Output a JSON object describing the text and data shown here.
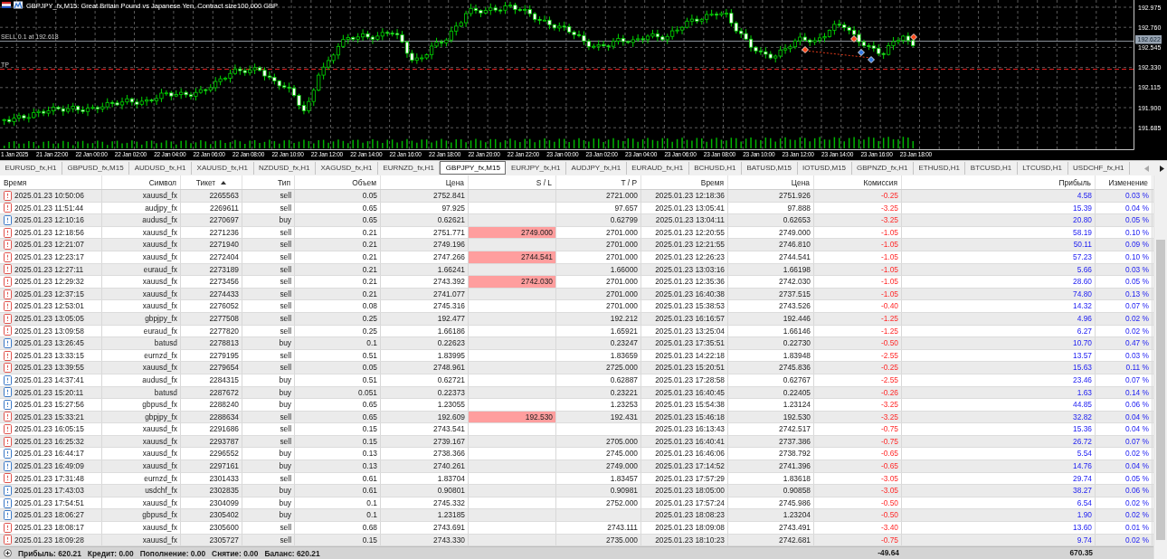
{
  "chart": {
    "title": "GBPJPY_fx,M15: Great Britain Pound vs Japanese Yen, Contract size100,000 GBP",
    "order_label": "SELL 0.1 at 192.618",
    "tp_label": "TP",
    "current_price": "192.622",
    "price_labels": [
      "192.975",
      "192.760",
      "192.545",
      "192.330",
      "192.115",
      "191.900",
      "191.685"
    ],
    "time_labels": [
      "1 Jan 2025",
      "21 Jan 22:00",
      "22 Jan 00:00",
      "22 Jan 02:00",
      "22 Jan 04:00",
      "22 Jan 06:00",
      "22 Jan 08:00",
      "22 Jan 10:00",
      "22 Jan 12:00",
      "22 Jan 14:00",
      "22 Jan 16:00",
      "22 Jan 18:00",
      "22 Jan 20:00",
      "22 Jan 22:00",
      "23 Jan 00:00",
      "23 Jan 02:00",
      "23 Jan 04:00",
      "23 Jan 06:00",
      "23 Jan 08:00",
      "23 Jan 10:00",
      "23 Jan 12:00",
      "23 Jan 14:00",
      "23 Jan 16:00",
      "23 Jan 18:00"
    ]
  },
  "tabs": [
    {
      "label": "EURUSD_fx,H1",
      "selected": false
    },
    {
      "label": "GBPUSD_fx,M15",
      "selected": false
    },
    {
      "label": "AUDUSD_fx,H1",
      "selected": false
    },
    {
      "label": "XAUUSD_fx,H1",
      "selected": false
    },
    {
      "label": "NZDUSD_fx,H1",
      "selected": false
    },
    {
      "label": "XAGUSD_fx,H1",
      "selected": false
    },
    {
      "label": "EURNZD_fx,H1",
      "selected": false
    },
    {
      "label": "GBPJPY_fx,M15",
      "selected": true
    },
    {
      "label": "EURJPY_fx,H1",
      "selected": false
    },
    {
      "label": "AUDJPY_fx,H1",
      "selected": false
    },
    {
      "label": "EURAUD_fx,H1",
      "selected": false
    },
    {
      "label": "BCHUSD,H1",
      "selected": false
    },
    {
      "label": "BATUSD,M15",
      "selected": false
    },
    {
      "label": "IOTUSD,M15",
      "selected": false
    },
    {
      "label": "GBPNZD_fx,H1",
      "selected": false
    },
    {
      "label": "ETHUSD,H1",
      "selected": false
    },
    {
      "label": "BTCUSD,H1",
      "selected": false
    },
    {
      "label": "LTCUSD,H1",
      "selected": false
    },
    {
      "label": "USDCHF_fx,H1",
      "selected": false
    }
  ],
  "tab_scroll": {
    "back_disabled": true,
    "forward_disabled": false
  },
  "table": {
    "columns": [
      {
        "label": "Время",
        "sorted": false
      },
      {
        "label": "Символ",
        "sorted": false
      },
      {
        "label": "Тикет",
        "sorted": true
      },
      {
        "label": "Тип",
        "sorted": false
      },
      {
        "label": "Объем",
        "sorted": false
      },
      {
        "label": "Цена",
        "sorted": false
      },
      {
        "label": "S / L",
        "sorted": false
      },
      {
        "label": "T / P",
        "sorted": false
      },
      {
        "label": "Время",
        "sorted": false
      },
      {
        "label": "Цена",
        "sorted": false
      },
      {
        "label": "Комиссия",
        "sorted": false
      },
      {
        "label": "Прибыль",
        "sorted": false
      },
      {
        "label": "Изменение",
        "sorted": false
      }
    ],
    "rows": [
      {
        "time": "2025.01.23 10:50:06",
        "symbol": "xauusd_fx",
        "ticket": "2265563",
        "type": "sell",
        "volume": "0.05",
        "price": "2752.841",
        "tp": "2721.000",
        "close_time": "2025.01.23 12:18:36",
        "close_price": "2751.926",
        "commission": "-0.25",
        "profit": "4.58",
        "change": "0.03 %",
        "kind": "sell",
        "sl_highlighted": false
      },
      {
        "time": "2025.01.23 11:51:44",
        "symbol": "audjpy_fx",
        "ticket": "2269611",
        "type": "sell",
        "volume": "0.65",
        "price": "97.925",
        "tp": "97.657",
        "close_time": "2025.01.23 13:05:41",
        "close_price": "97.888",
        "commission": "-3.25",
        "profit": "15.39",
        "change": "0.04 %",
        "kind": "sell",
        "sl_highlighted": false
      },
      {
        "time": "2025.01.23 12:10:16",
        "symbol": "audusd_fx",
        "ticket": "2270697",
        "type": "buy",
        "volume": "0.65",
        "price": "0.62621",
        "tp": "0.62799",
        "close_time": "2025.01.23 13:04:11",
        "close_price": "0.62653",
        "commission": "-3.25",
        "profit": "20.80",
        "change": "0.05 %",
        "kind": "buy",
        "sl_highlighted": false
      },
      {
        "time": "2025.01.23 12:18:56",
        "symbol": "xauusd_fx",
        "ticket": "2271236",
        "type": "sell",
        "volume": "0.21",
        "price": "2751.771",
        "sl": "2749.000",
        "tp": "2701.000",
        "close_time": "2025.01.23 12:20:55",
        "close_price": "2749.000",
        "commission": "-1.05",
        "profit": "58.19",
        "change": "0.10 %",
        "kind": "sell",
        "sl_highlighted": true
      },
      {
        "time": "2025.01.23 12:21:07",
        "symbol": "xauusd_fx",
        "ticket": "2271940",
        "type": "sell",
        "volume": "0.21",
        "price": "2749.196",
        "tp": "2701.000",
        "close_time": "2025.01.23 12:21:55",
        "close_price": "2746.810",
        "commission": "-1.05",
        "profit": "50.11",
        "change": "0.09 %",
        "kind": "sell",
        "sl_highlighted": false
      },
      {
        "time": "2025.01.23 12:23:17",
        "symbol": "xauusd_fx",
        "ticket": "2272404",
        "type": "sell",
        "volume": "0.21",
        "price": "2747.266",
        "sl": "2744.541",
        "tp": "2701.000",
        "close_time": "2025.01.23 12:26:23",
        "close_price": "2744.541",
        "commission": "-1.05",
        "profit": "57.23",
        "change": "0.10 %",
        "kind": "sell",
        "sl_highlighted": true
      },
      {
        "time": "2025.01.23 12:27:11",
        "symbol": "euraud_fx",
        "ticket": "2273189",
        "type": "sell",
        "volume": "0.21",
        "price": "1.66241",
        "tp": "1.66000",
        "close_time": "2025.01.23 13:03:16",
        "close_price": "1.66198",
        "commission": "-1.05",
        "profit": "5.66",
        "change": "0.03 %",
        "kind": "sell",
        "sl_highlighted": false
      },
      {
        "time": "2025.01.23 12:29:32",
        "symbol": "xauusd_fx",
        "ticket": "2273456",
        "type": "sell",
        "volume": "0.21",
        "price": "2743.392",
        "sl": "2742.030",
        "tp": "2701.000",
        "close_time": "2025.01.23 12:35:36",
        "close_price": "2742.030",
        "commission": "-1.05",
        "profit": "28.60",
        "change": "0.05 %",
        "kind": "sell",
        "sl_highlighted": true
      },
      {
        "time": "2025.01.23 12:37:15",
        "symbol": "xauusd_fx",
        "ticket": "2274433",
        "type": "sell",
        "volume": "0.21",
        "price": "2741.077",
        "tp": "2701.000",
        "close_time": "2025.01.23 16:40:38",
        "close_price": "2737.515",
        "commission": "-1.05",
        "profit": "74.80",
        "change": "0.13 %",
        "kind": "sell",
        "sl_highlighted": false
      },
      {
        "time": "2025.01.23 12:53:01",
        "symbol": "xauusd_fx",
        "ticket": "2276052",
        "type": "sell",
        "volume": "0.08",
        "price": "2745.316",
        "tp": "2701.000",
        "close_time": "2025.01.23 15:38:53",
        "close_price": "2743.526",
        "commission": "-0.40",
        "profit": "14.32",
        "change": "0.07 %",
        "kind": "sell",
        "sl_highlighted": false
      },
      {
        "time": "2025.01.23 13:05:05",
        "symbol": "gbpjpy_fx",
        "ticket": "2277508",
        "type": "sell",
        "volume": "0.25",
        "price": "192.477",
        "tp": "192.212",
        "close_time": "2025.01.23 16:16:57",
        "close_price": "192.446",
        "commission": "-1.25",
        "profit": "4.96",
        "change": "0.02 %",
        "kind": "sell",
        "sl_highlighted": false
      },
      {
        "time": "2025.01.23 13:09:58",
        "symbol": "euraud_fx",
        "ticket": "2277820",
        "type": "sell",
        "volume": "0.25",
        "price": "1.66186",
        "tp": "1.65921",
        "close_time": "2025.01.23 13:25:04",
        "close_price": "1.66146",
        "commission": "-1.25",
        "profit": "6.27",
        "change": "0.02 %",
        "kind": "sell",
        "sl_highlighted": false
      },
      {
        "time": "2025.01.23 13:26:45",
        "symbol": "batusd",
        "ticket": "2278813",
        "type": "buy",
        "volume": "0.1",
        "price": "0.22623",
        "tp": "0.23247",
        "close_time": "2025.01.23 17:35:51",
        "close_price": "0.22730",
        "commission": "-0.50",
        "profit": "10.70",
        "change": "0.47 %",
        "kind": "buy",
        "sl_highlighted": false
      },
      {
        "time": "2025.01.23 13:33:15",
        "symbol": "eurnzd_fx",
        "ticket": "2279195",
        "type": "sell",
        "volume": "0.51",
        "price": "1.83995",
        "tp": "1.83659",
        "close_time": "2025.01.23 14:22:18",
        "close_price": "1.83948",
        "commission": "-2.55",
        "profit": "13.57",
        "change": "0.03 %",
        "kind": "sell",
        "sl_highlighted": false
      },
      {
        "time": "2025.01.23 13:39:55",
        "symbol": "xauusd_fx",
        "ticket": "2279654",
        "type": "sell",
        "volume": "0.05",
        "price": "2748.961",
        "tp": "2725.000",
        "close_time": "2025.01.23 15:20:51",
        "close_price": "2745.836",
        "commission": "-0.25",
        "profit": "15.63",
        "change": "0.11 %",
        "kind": "sell",
        "sl_highlighted": false
      },
      {
        "time": "2025.01.23 14:37:41",
        "symbol": "audusd_fx",
        "ticket": "2284315",
        "type": "buy",
        "volume": "0.51",
        "price": "0.62721",
        "tp": "0.62887",
        "close_time": "2025.01.23 17:28:58",
        "close_price": "0.62767",
        "commission": "-2.55",
        "profit": "23.46",
        "change": "0.07 %",
        "kind": "buy",
        "sl_highlighted": false
      },
      {
        "time": "2025.01.23 15:20:11",
        "symbol": "batusd",
        "ticket": "2287672",
        "type": "buy",
        "volume": "0.051",
        "price": "0.22373",
        "tp": "0.23221",
        "close_time": "2025.01.23 16:40:45",
        "close_price": "0.22405",
        "commission": "-0.26",
        "profit": "1.63",
        "change": "0.14 %",
        "kind": "buy",
        "sl_highlighted": false
      },
      {
        "time": "2025.01.23 15:27:56",
        "symbol": "gbpusd_fx",
        "ticket": "2288240",
        "type": "buy",
        "volume": "0.65",
        "price": "1.23055",
        "tp": "1.23253",
        "close_time": "2025.01.23 15:54:38",
        "close_price": "1.23124",
        "commission": "-3.25",
        "profit": "44.85",
        "change": "0.06 %",
        "kind": "buy",
        "sl_highlighted": false
      },
      {
        "time": "2025.01.23 15:33:21",
        "symbol": "gbpjpy_fx",
        "ticket": "2288634",
        "type": "sell",
        "volume": "0.65",
        "price": "192.609",
        "sl": "192.530",
        "tp": "192.431",
        "close_time": "2025.01.23 15:46:18",
        "close_price": "192.530",
        "commission": "-3.25",
        "profit": "32.82",
        "change": "0.04 %",
        "kind": "sell",
        "sl_highlighted": true
      },
      {
        "time": "2025.01.23 16:05:15",
        "symbol": "xauusd_fx",
        "ticket": "2291686",
        "type": "sell",
        "volume": "0.15",
        "price": "2743.541",
        "close_time": "2025.01.23 16:13:43",
        "close_price": "2742.517",
        "commission": "-0.75",
        "profit": "15.36",
        "change": "0.04 %",
        "kind": "sell",
        "sl_highlighted": false
      },
      {
        "time": "2025.01.23 16:25:32",
        "symbol": "xauusd_fx",
        "ticket": "2293787",
        "type": "sell",
        "volume": "0.15",
        "price": "2739.167",
        "tp": "2705.000",
        "close_time": "2025.01.23 16:40:41",
        "close_price": "2737.386",
        "commission": "-0.75",
        "profit": "26.72",
        "change": "0.07 %",
        "kind": "sell",
        "sl_highlighted": false
      },
      {
        "time": "2025.01.23 16:44:17",
        "symbol": "xauusd_fx",
        "ticket": "2296552",
        "type": "buy",
        "volume": "0.13",
        "price": "2738.366",
        "tp": "2745.000",
        "close_time": "2025.01.23 16:46:06",
        "close_price": "2738.792",
        "commission": "-0.65",
        "profit": "5.54",
        "change": "0.02 %",
        "kind": "buy",
        "sl_highlighted": false
      },
      {
        "time": "2025.01.23 16:49:09",
        "symbol": "xauusd_fx",
        "ticket": "2297161",
        "type": "buy",
        "volume": "0.13",
        "price": "2740.261",
        "tp": "2749.000",
        "close_time": "2025.01.23 17:14:52",
        "close_price": "2741.396",
        "commission": "-0.65",
        "profit": "14.76",
        "change": "0.04 %",
        "kind": "buy",
        "sl_highlighted": false
      },
      {
        "time": "2025.01.23 17:31:48",
        "symbol": "eurnzd_fx",
        "ticket": "2301433",
        "type": "sell",
        "volume": "0.61",
        "price": "1.83704",
        "tp": "1.83457",
        "close_time": "2025.01.23 17:57:29",
        "close_price": "1.83618",
        "commission": "-3.05",
        "profit": "29.74",
        "change": "0.05 %",
        "kind": "sell",
        "sl_highlighted": false
      },
      {
        "time": "2025.01.23 17:43:03",
        "symbol": "usdchf_fx",
        "ticket": "2302835",
        "type": "buy",
        "volume": "0.61",
        "price": "0.90801",
        "tp": "0.90981",
        "close_time": "2025.01.23 18:05:00",
        "close_price": "0.90858",
        "commission": "-3.05",
        "profit": "38.27",
        "change": "0.06 %",
        "kind": "buy",
        "sl_highlighted": false
      },
      {
        "time": "2025.01.23 17:54:51",
        "symbol": "xauusd_fx",
        "ticket": "2304099",
        "type": "buy",
        "volume": "0.1",
        "price": "2745.332",
        "tp": "2752.000",
        "close_time": "2025.01.23 17:57:24",
        "close_price": "2745.986",
        "commission": "-0.50",
        "profit": "6.54",
        "change": "0.02 %",
        "kind": "buy",
        "sl_highlighted": false
      },
      {
        "time": "2025.01.23 18:06:27",
        "symbol": "gbpusd_fx",
        "ticket": "2305402",
        "type": "buy",
        "volume": "0.1",
        "price": "1.23185",
        "close_time": "2025.01.23 18:08:23",
        "close_price": "1.23204",
        "commission": "-0.50",
        "profit": "1.90",
        "change": "0.02 %",
        "kind": "buy",
        "sl_highlighted": false
      },
      {
        "time": "2025.01.23 18:08:17",
        "symbol": "xauusd_fx",
        "ticket": "2305600",
        "type": "sell",
        "volume": "0.68",
        "price": "2743.691",
        "tp": "2743.111",
        "close_time": "2025.01.23 18:09:08",
        "close_price": "2743.491",
        "commission": "-3.40",
        "profit": "13.60",
        "change": "0.01 %",
        "kind": "sell",
        "sl_highlighted": false
      },
      {
        "time": "2025.01.23 18:09:28",
        "symbol": "xauusd_fx",
        "ticket": "2305727",
        "type": "sell",
        "volume": "0.15",
        "price": "2743.330",
        "tp": "2735.000",
        "close_time": "2025.01.23 18:10:23",
        "close_price": "2742.681",
        "commission": "-0.75",
        "profit": "9.74",
        "change": "0.02 %",
        "kind": "sell",
        "sl_highlighted": false
      }
    ]
  },
  "summary": {
    "items": [
      "Прибыль: 620.21",
      "Кредит: 0.00",
      "Пополнение: 0.00",
      "Снятие: 0.00",
      "Баланс: 620.21"
    ],
    "commission_total": "-49.64",
    "profit_total": "670.35"
  }
}
